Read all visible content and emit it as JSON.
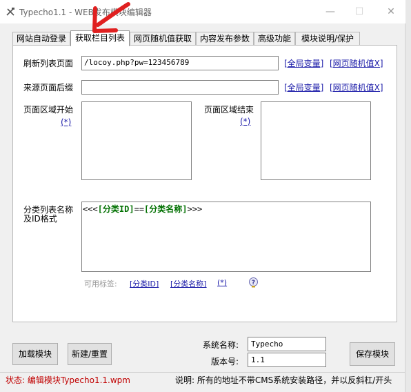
{
  "window": {
    "title": "Typecho1.1 - WEB发布模块编辑器",
    "minimize": "—",
    "maximize": "☐",
    "close": "✕"
  },
  "tabs": [
    {
      "label": "网站自动登录",
      "active": false
    },
    {
      "label": "获取栏目列表",
      "active": true
    },
    {
      "label": "网页随机值获取",
      "active": false
    },
    {
      "label": "内容发布参数",
      "active": false
    },
    {
      "label": "高级功能",
      "active": false
    },
    {
      "label": "模块说明/保护",
      "active": false
    }
  ],
  "form": {
    "refresh_list_label": "刷新列表页面",
    "refresh_list_value": "/locoy.php?pw=123456789",
    "source_suffix_label": "来源页面后缀",
    "source_suffix_value": "",
    "global_var_link": "[全局变量]",
    "random_value_link": "[网页随机值X]",
    "region_start_label": "页面区域开始",
    "region_start_star": "(*)",
    "region_end_label": "页面区域结束",
    "region_end_star": "(*)",
    "category_format_label_1": "分类列表名称",
    "category_format_label_2": "及ID格式",
    "format_prefix": "<<<",
    "format_id": "[分类ID]",
    "format_sep": "==",
    "format_name": "[分类名称]",
    "format_suffix": ">>>",
    "available_tags_label": "可用标签:",
    "tag_category_id": "[分类ID]",
    "tag_category_name": "[分类名称]",
    "tag_star": "(*)"
  },
  "bottom": {
    "load_module": "加载模块",
    "new_reset": "新建/重置",
    "system_name_label": "系统名称:",
    "system_name_value": "Typecho",
    "version_label": "版本号:",
    "version_value": "1.1",
    "save_module": "保存模块"
  },
  "status": {
    "left": "状态: 编辑模块Typecho1.1.wpm",
    "right": "说明: 所有的地址不带CMS系统安装路径，并以反斜杠/开头"
  },
  "colors": {
    "link": "#1a1aa8",
    "status_red": "#c00000",
    "format_green": "#007000",
    "arrow_red": "#e02020"
  }
}
